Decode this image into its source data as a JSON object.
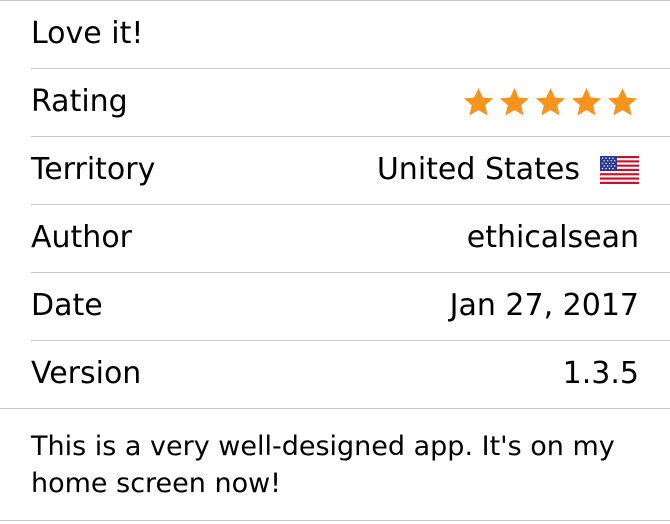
{
  "review": {
    "title": "Love it!",
    "rating": {
      "label": "Rating",
      "value": 5,
      "max": 5,
      "star_color": "#f7941d"
    },
    "territory": {
      "label": "Territory",
      "value": "United States",
      "flag_icon": "us-flag-icon"
    },
    "author": {
      "label": "Author",
      "value": "ethicalsean"
    },
    "date": {
      "label": "Date",
      "value": "Jan 27, 2017"
    },
    "version": {
      "label": "Version",
      "value": "1.3.5"
    },
    "body": "This is a very well-designed app. It's on my home screen now!"
  },
  "colors": {
    "separator": "#c8c7cc",
    "text": "#000000",
    "background": "#ffffff"
  }
}
